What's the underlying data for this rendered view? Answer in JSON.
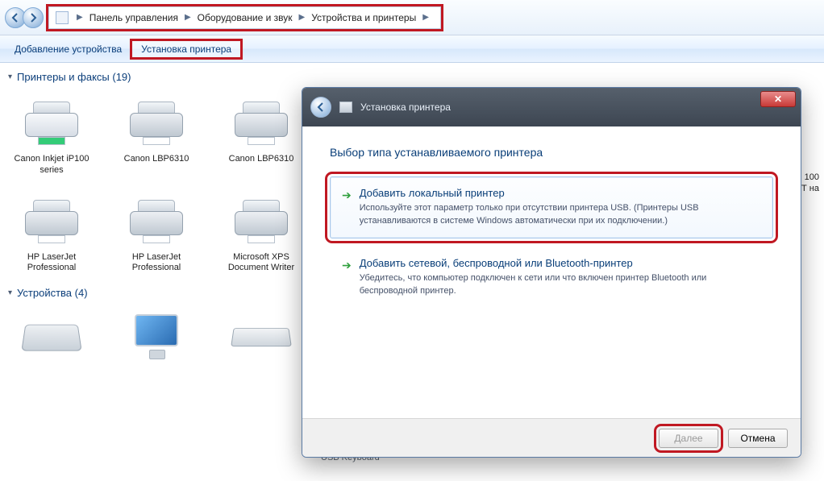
{
  "breadcrumb": {
    "items": [
      "Панель управления",
      "Оборудование и звук",
      "Устройства и принтеры"
    ]
  },
  "toolbar": {
    "add_device": "Добавление устройства",
    "add_printer": "Установка принтера"
  },
  "sections": {
    "printers": {
      "title": "Принтеры и факсы",
      "count": "(19)"
    },
    "devices": {
      "title": "Устройства",
      "count": "(4)"
    }
  },
  "printers": [
    {
      "label": "Canon Inkjet iP100 series"
    },
    {
      "label": "Canon LBP6310"
    },
    {
      "label": "Canon LBP6310"
    },
    {
      "label": "HP LaserJet Professional"
    },
    {
      "label": "HP LaserJet Professional"
    },
    {
      "label": "Microsoft XPS Document Writer"
    }
  ],
  "edge_label": {
    "l1": "100",
    "l2": "Т на"
  },
  "wizard": {
    "title": "Установка принтера",
    "heading": "Выбор типа устанавливаемого принтера",
    "options": [
      {
        "title": "Добавить локальный принтер",
        "desc": "Используйте этот параметр только при отсутствии принтера USB. (Принтеры USB устанавливаются в системе Windows автоматически при их подключении.)"
      },
      {
        "title": "Добавить сетевой, беспроводной или Bluetooth-принтер",
        "desc": "Убедитесь, что компьютер подключен к сети или что включен принтер Bluetooth или беспроводной принтер."
      }
    ],
    "buttons": {
      "next": "Далее",
      "cancel": "Отмена"
    }
  },
  "bg_item": "USB Keyboard"
}
